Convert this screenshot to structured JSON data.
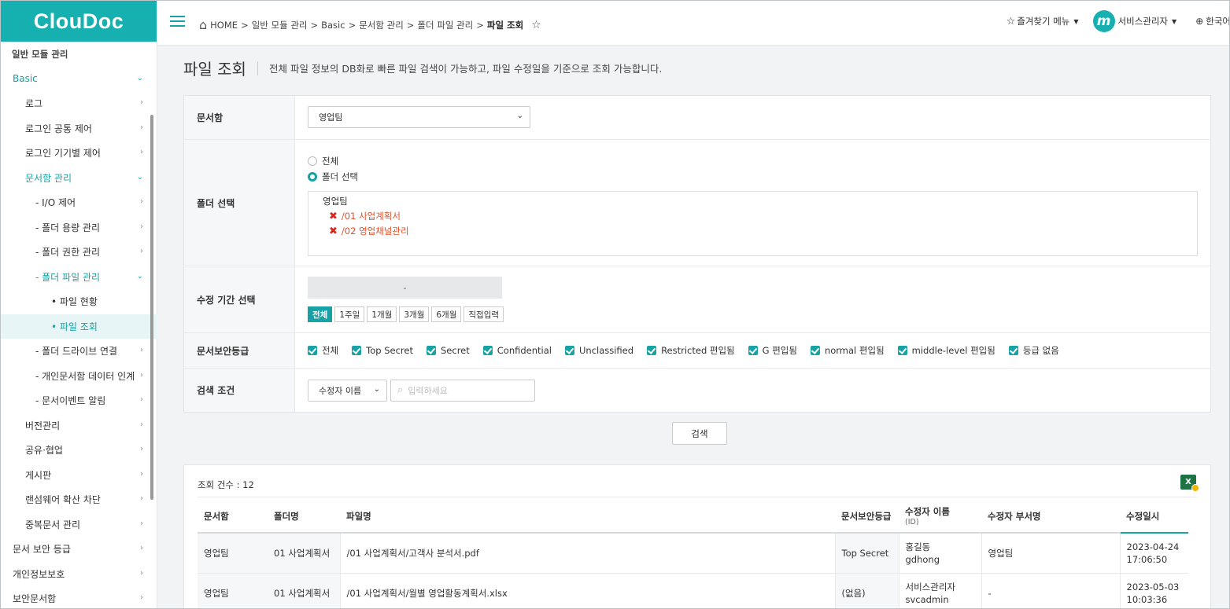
{
  "app": {
    "logo": "ClouDoc"
  },
  "sidebar": {
    "items": [
      {
        "label": "일반 모듈 관리",
        "level": "head"
      },
      {
        "label": "Basic",
        "level": "l0",
        "state": "active",
        "arrow": "⌄"
      },
      {
        "label": "로그",
        "level": "l1",
        "arrow": "›"
      },
      {
        "label": "로그인 공통 제어",
        "level": "l1",
        "arrow": "›"
      },
      {
        "label": "로그인 기기별 제어",
        "level": "l1",
        "arrow": "›"
      },
      {
        "label": "문서함 관리",
        "level": "l1",
        "state": "active",
        "arrow": "⌄"
      },
      {
        "label": "- I/O 제어",
        "level": "l2",
        "arrow": "›"
      },
      {
        "label": "- 폴더 용량 관리",
        "level": "l2",
        "arrow": "›"
      },
      {
        "label": "- 폴더 권한 관리",
        "level": "l2",
        "arrow": "›"
      },
      {
        "label": "- 폴더 파일 관리",
        "level": "l2",
        "state": "active",
        "arrow": "⌄"
      },
      {
        "label": "• 파일 현황",
        "level": "l3",
        "arrow": ""
      },
      {
        "label": "• 파일 조회",
        "level": "l3",
        "state": "selected",
        "arrow": ""
      },
      {
        "label": "- 폴더 드라이브 연결",
        "level": "l2",
        "arrow": "›"
      },
      {
        "label": "- 개인문서함 데이터 인계",
        "level": "l2",
        "arrow": "›"
      },
      {
        "label": "- 문서이벤트 알림",
        "level": "l2",
        "arrow": "›"
      },
      {
        "label": "버전관리",
        "level": "l1",
        "arrow": "›"
      },
      {
        "label": "공유·협업",
        "level": "l1",
        "arrow": "›"
      },
      {
        "label": "게시판",
        "level": "l1",
        "arrow": "›"
      },
      {
        "label": "랜섬웨어 확산 차단",
        "level": "l1",
        "arrow": "›"
      },
      {
        "label": "중복문서 관리",
        "level": "l1",
        "arrow": "›"
      },
      {
        "label": "문서 보안 등급",
        "level": "l0",
        "arrow": "›"
      },
      {
        "label": "개인정보보호",
        "level": "l0",
        "arrow": "›"
      },
      {
        "label": "보안문서함",
        "level": "l0",
        "arrow": "›"
      }
    ]
  },
  "topbar": {
    "breadcrumb": [
      "HOME",
      "일반 모듈 관리",
      "Basic",
      "문서함 관리",
      "폴더 파일 관리"
    ],
    "breadcrumb_sep": ">",
    "breadcrumb_current": "파일 조회",
    "favorites": "즐겨찾기 메뉴",
    "user": "서비스관리자",
    "avatar_letter": "m",
    "language": "한국어"
  },
  "page": {
    "title": "파일 조회",
    "description": "전체 파일 정보의 DB화로 빠른 파일 검색이 가능하고, 파일 수정일을 기준으로 조회 가능합니다."
  },
  "form": {
    "docbox": {
      "label": "문서함",
      "selected": "영업팀"
    },
    "folder": {
      "label": "폴더 선택",
      "options": [
        "전체",
        "폴더 선택"
      ],
      "selected_index": 1,
      "root": "영업팀",
      "items": [
        "/01 사업계획서",
        "/02 영업채널관리"
      ]
    },
    "period": {
      "label": "수정 기간 선택",
      "range_sep": "-",
      "buttons": [
        "전체",
        "1주일",
        "1개월",
        "3개월",
        "6개월",
        "직접입력"
      ],
      "active_index": 0
    },
    "security": {
      "label": "문서보안등급",
      "options": [
        "전체",
        "Top Secret",
        "Secret",
        "Confidential",
        "Unclassified",
        "Restricted 편입됨",
        "G 편입됨",
        "normal 편입됨",
        "middle-level 편입됨",
        "등급 없음"
      ]
    },
    "search": {
      "label": "검색 조건",
      "field": "수정자 이름",
      "placeholder": "입력하세요"
    },
    "search_button": "검색"
  },
  "results": {
    "count_label": "조회 건수 : 12",
    "excel_letter": "X",
    "columns": [
      "문서함",
      "폴더명",
      "파일명",
      "문서보안등급",
      "수정자 이름",
      "수정자 부서명",
      "수정일시"
    ],
    "column_sub": "(ID)",
    "rows": [
      {
        "docbox": "영업팀",
        "folder": "01 사업계획서",
        "file": "/01 사업계획서/고객사 분석서.pdf",
        "grade": "Top Secret",
        "name": "홍길동",
        "id": "gdhong",
        "dept": "영업팀",
        "date": "2023-04-24",
        "time": "17:06:50"
      },
      {
        "docbox": "영업팀",
        "folder": "01 사업계획서",
        "file": "/01 사업계획서/월별 영업활동계획서.xlsx",
        "grade": "(없음)",
        "name": "서비스관리자",
        "id": "svcadmin",
        "dept": "-",
        "date": "2023-05-03",
        "time": "10:03:36"
      }
    ]
  }
}
